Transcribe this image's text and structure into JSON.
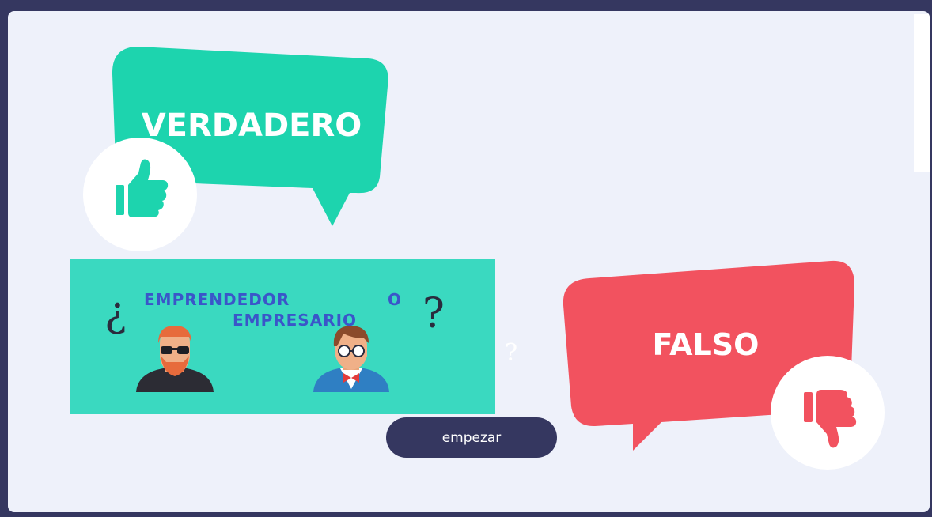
{
  "true_bubble": {
    "label": "VERDADERO",
    "color": "#1dd4ae",
    "icon": "thumbs-up-icon"
  },
  "false_bubble": {
    "label": "FALSO",
    "color": "#f2525f",
    "icon": "thumbs-down-icon"
  },
  "banner": {
    "open_q": "¿",
    "word1": "EMPRENDEDOR",
    "connector": "O",
    "word2": "EMPRESARIO",
    "close_q": "?",
    "background": "#3ad9c0"
  },
  "stray_mark": "?",
  "start_button": {
    "label": "empezar"
  }
}
